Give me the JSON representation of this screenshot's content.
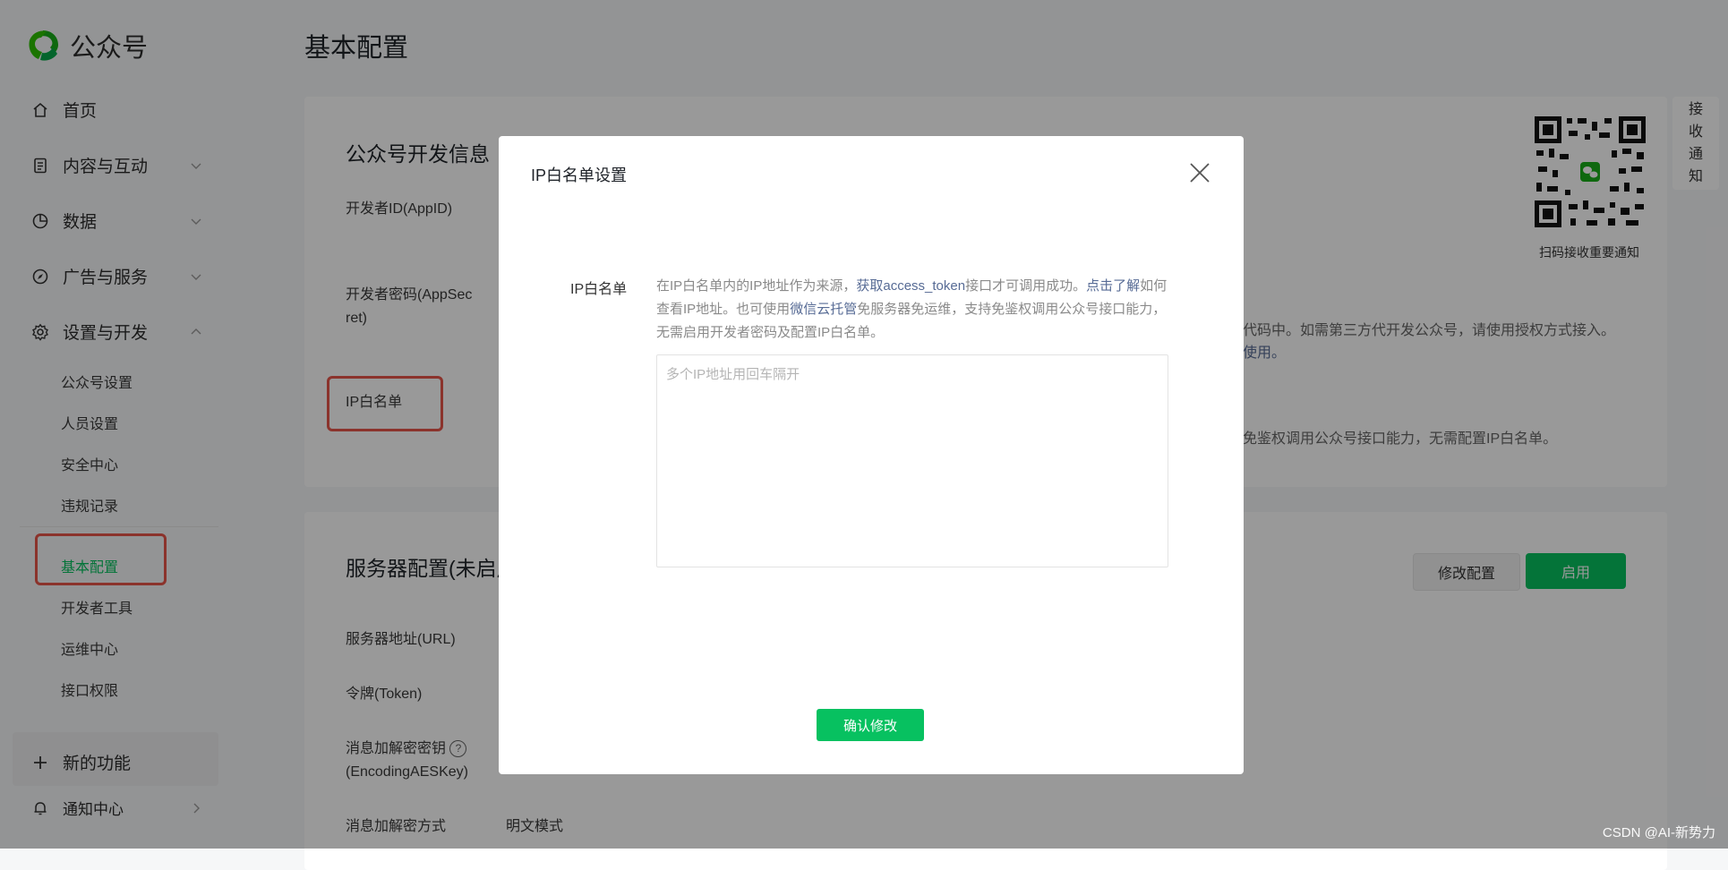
{
  "brand": {
    "name": "公众号"
  },
  "page_title": "基本配置",
  "sidebar": {
    "items": [
      {
        "label": "首页",
        "icon": "home-icon"
      },
      {
        "label": "内容与互动",
        "icon": "document-icon"
      },
      {
        "label": "数据",
        "icon": "pie-chart-icon"
      },
      {
        "label": "广告与服务",
        "icon": "compass-icon"
      },
      {
        "label": "设置与开发",
        "icon": "gear-icon"
      }
    ],
    "sub_items": [
      "公众号设置",
      "人员设置",
      "安全中心",
      "违规记录",
      "基本配置",
      "开发者工具",
      "运维中心",
      "接口权限"
    ],
    "new_features": "新的功能",
    "notifications": "通知中心"
  },
  "dev_info": {
    "title": "公众号开发信息",
    "appid_label": "开发者ID(AppID)",
    "secret_label_1": "开发者密码(AppSec",
    "secret_label_2": "ret)",
    "ip_whitelist_label": "IP白名单",
    "bg_text_1": "代码中。如需第三方代开发公众号，请使用授权方式接入。",
    "bg_text_2": "使用。",
    "bg_text_3": "免鉴权调用公众号接口能力，无需配置IP白名单。"
  },
  "server_config": {
    "title": "服务器配置(未启用)",
    "url_label": "服务器地址(URL)",
    "token_label": "令牌(Token)",
    "aes_label_1": "消息加解密密钥",
    "aes_label_2": "(EncodingAESKey)",
    "mode_label": "消息加解密方式",
    "mode_value": "明文模式",
    "modify_button": "修改配置",
    "enable_button": "启用"
  },
  "qr": {
    "caption": "扫码接收重要通知"
  },
  "side_tab": {
    "chars": [
      "接",
      "收",
      "通",
      "知"
    ]
  },
  "modal": {
    "title": "IP白名单设置",
    "field_label": "IP白名单",
    "desc_part1": "在IP白名单内的IP地址作为来源，",
    "desc_link1": "获取access_token",
    "desc_part2": "接口才可调用成功。",
    "desc_link2": "点击了解",
    "desc_part3": "如何查看IP地址。也可使用",
    "desc_link3": "微信云托管",
    "desc_part4": "免服务器免运维，支持免鉴权调用公众号接口能力，无需启用开发者密码及配置IP白名单。",
    "textarea_placeholder": "多个IP地址用回车隔开",
    "textarea_value": "",
    "confirm_button": "确认修改"
  },
  "watermark": "CSDN @AI-新势力",
  "colors": {
    "brand_green": "#07c160",
    "link_blue": "#576b95",
    "highlight_red": "#e8554a"
  }
}
